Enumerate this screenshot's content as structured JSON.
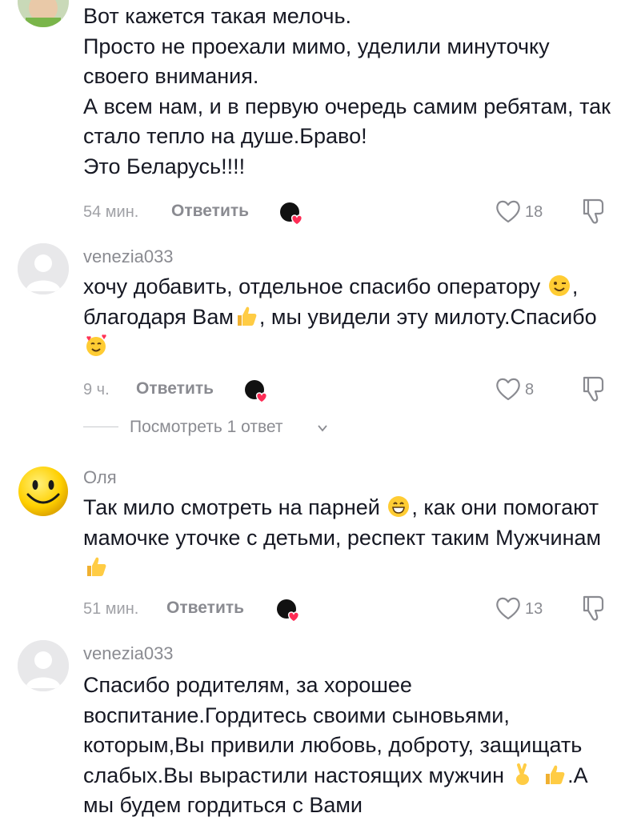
{
  "comments": [
    {
      "username": "",
      "lines": [
        "Вот кажется такая мелочь.",
        "Просто не проехали мимо, уделили минуточку своего внимания.",
        "А всем нам, и в первую очередь самим ребятам, так стало тепло на душе.Браво!",
        "Это Беларусь!!!!"
      ],
      "time": "54 мин.",
      "reply_label": "Ответить",
      "likes": "18"
    },
    {
      "username": "venezia033",
      "text_parts": [
        "хочу добавить, отдельное спасибо оператору ",
        ", благодаря Вам",
        ", мы увидели эту милоту.Спасибо"
      ],
      "time": "9 ч.",
      "reply_label": "Ответить",
      "likes": "8",
      "view_replies": "Посмотреть 1 ответ"
    },
    {
      "username": "Оля",
      "text_parts": [
        "Так мило смотреть на парней ",
        ", как они помогают мамочке уточке с детьми, респект таким Мужчинам "
      ],
      "time": "51 мин.",
      "reply_label": "Ответить",
      "likes": "13"
    },
    {
      "username": "venezia033",
      "text_parts": [
        "Спасибо родителям, за хорошее воспитание.Гордитесь своими сыновьями, которым,Вы привили любовь, доброту, защищать слабых.Вы вырастили настоящих мужчин ",
        " ",
        ".А мы будем гордиться с Вами"
      ]
    }
  ],
  "icons": {
    "like": "heart-outline-icon",
    "dislike": "thumb-down-icon",
    "creator_liked": "creator-avatar-heart-icon",
    "chevron": "chevron-down-icon"
  },
  "colors": {
    "text": "#161823",
    "secondary": "#8a8b91",
    "heart_red": "#fe2c55"
  }
}
